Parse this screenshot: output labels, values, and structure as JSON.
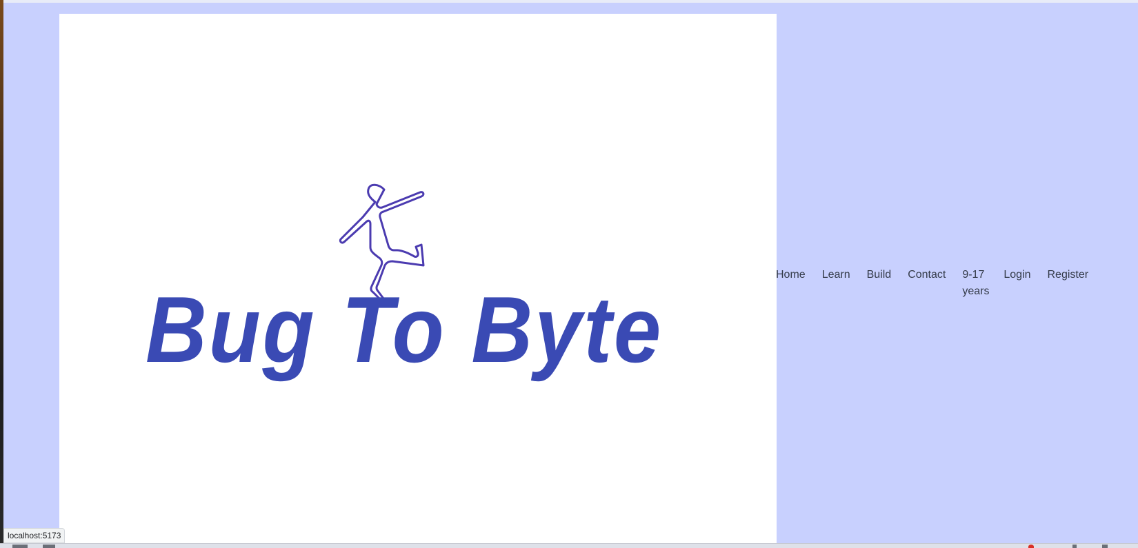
{
  "brand": {
    "name": "Bug To Byte",
    "color": "#3a4ab4",
    "mascot_icon": "dancing-stick-figure-outline",
    "mascot_color": "#4b3bb0"
  },
  "nav": {
    "items": [
      {
        "label": "Home"
      },
      {
        "label": "Learn"
      },
      {
        "label": "Build"
      },
      {
        "label": "Contact"
      },
      {
        "label": "9-17 years"
      },
      {
        "label": "Login"
      },
      {
        "label": "Register"
      }
    ]
  },
  "theme": {
    "page_background": "#c8d0fe",
    "hero_background": "#ffffff",
    "nav_text": "#333a48"
  },
  "status_bar": {
    "url": "localhost:5173"
  }
}
